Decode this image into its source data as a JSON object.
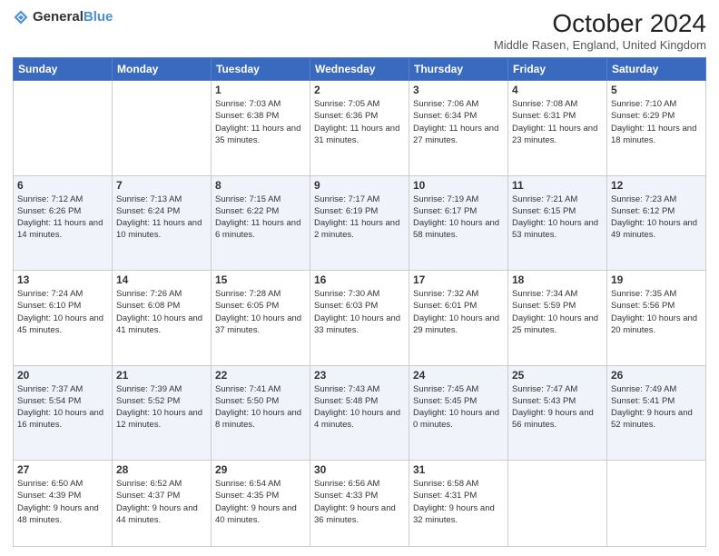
{
  "logo": {
    "text_general": "General",
    "text_blue": "Blue"
  },
  "header": {
    "month_title": "October 2024",
    "location": "Middle Rasen, England, United Kingdom"
  },
  "weekdays": [
    "Sunday",
    "Monday",
    "Tuesday",
    "Wednesday",
    "Thursday",
    "Friday",
    "Saturday"
  ],
  "weeks": [
    [
      {
        "day": "",
        "sunrise": "",
        "sunset": "",
        "daylight": ""
      },
      {
        "day": "",
        "sunrise": "",
        "sunset": "",
        "daylight": ""
      },
      {
        "day": "1",
        "sunrise": "Sunrise: 7:03 AM",
        "sunset": "Sunset: 6:38 PM",
        "daylight": "Daylight: 11 hours and 35 minutes."
      },
      {
        "day": "2",
        "sunrise": "Sunrise: 7:05 AM",
        "sunset": "Sunset: 6:36 PM",
        "daylight": "Daylight: 11 hours and 31 minutes."
      },
      {
        "day": "3",
        "sunrise": "Sunrise: 7:06 AM",
        "sunset": "Sunset: 6:34 PM",
        "daylight": "Daylight: 11 hours and 27 minutes."
      },
      {
        "day": "4",
        "sunrise": "Sunrise: 7:08 AM",
        "sunset": "Sunset: 6:31 PM",
        "daylight": "Daylight: 11 hours and 23 minutes."
      },
      {
        "day": "5",
        "sunrise": "Sunrise: 7:10 AM",
        "sunset": "Sunset: 6:29 PM",
        "daylight": "Daylight: 11 hours and 18 minutes."
      }
    ],
    [
      {
        "day": "6",
        "sunrise": "Sunrise: 7:12 AM",
        "sunset": "Sunset: 6:26 PM",
        "daylight": "Daylight: 11 hours and 14 minutes."
      },
      {
        "day": "7",
        "sunrise": "Sunrise: 7:13 AM",
        "sunset": "Sunset: 6:24 PM",
        "daylight": "Daylight: 11 hours and 10 minutes."
      },
      {
        "day": "8",
        "sunrise": "Sunrise: 7:15 AM",
        "sunset": "Sunset: 6:22 PM",
        "daylight": "Daylight: 11 hours and 6 minutes."
      },
      {
        "day": "9",
        "sunrise": "Sunrise: 7:17 AM",
        "sunset": "Sunset: 6:19 PM",
        "daylight": "Daylight: 11 hours and 2 minutes."
      },
      {
        "day": "10",
        "sunrise": "Sunrise: 7:19 AM",
        "sunset": "Sunset: 6:17 PM",
        "daylight": "Daylight: 10 hours and 58 minutes."
      },
      {
        "day": "11",
        "sunrise": "Sunrise: 7:21 AM",
        "sunset": "Sunset: 6:15 PM",
        "daylight": "Daylight: 10 hours and 53 minutes."
      },
      {
        "day": "12",
        "sunrise": "Sunrise: 7:23 AM",
        "sunset": "Sunset: 6:12 PM",
        "daylight": "Daylight: 10 hours and 49 minutes."
      }
    ],
    [
      {
        "day": "13",
        "sunrise": "Sunrise: 7:24 AM",
        "sunset": "Sunset: 6:10 PM",
        "daylight": "Daylight: 10 hours and 45 minutes."
      },
      {
        "day": "14",
        "sunrise": "Sunrise: 7:26 AM",
        "sunset": "Sunset: 6:08 PM",
        "daylight": "Daylight: 10 hours and 41 minutes."
      },
      {
        "day": "15",
        "sunrise": "Sunrise: 7:28 AM",
        "sunset": "Sunset: 6:05 PM",
        "daylight": "Daylight: 10 hours and 37 minutes."
      },
      {
        "day": "16",
        "sunrise": "Sunrise: 7:30 AM",
        "sunset": "Sunset: 6:03 PM",
        "daylight": "Daylight: 10 hours and 33 minutes."
      },
      {
        "day": "17",
        "sunrise": "Sunrise: 7:32 AM",
        "sunset": "Sunset: 6:01 PM",
        "daylight": "Daylight: 10 hours and 29 minutes."
      },
      {
        "day": "18",
        "sunrise": "Sunrise: 7:34 AM",
        "sunset": "Sunset: 5:59 PM",
        "daylight": "Daylight: 10 hours and 25 minutes."
      },
      {
        "day": "19",
        "sunrise": "Sunrise: 7:35 AM",
        "sunset": "Sunset: 5:56 PM",
        "daylight": "Daylight: 10 hours and 20 minutes."
      }
    ],
    [
      {
        "day": "20",
        "sunrise": "Sunrise: 7:37 AM",
        "sunset": "Sunset: 5:54 PM",
        "daylight": "Daylight: 10 hours and 16 minutes."
      },
      {
        "day": "21",
        "sunrise": "Sunrise: 7:39 AM",
        "sunset": "Sunset: 5:52 PM",
        "daylight": "Daylight: 10 hours and 12 minutes."
      },
      {
        "day": "22",
        "sunrise": "Sunrise: 7:41 AM",
        "sunset": "Sunset: 5:50 PM",
        "daylight": "Daylight: 10 hours and 8 minutes."
      },
      {
        "day": "23",
        "sunrise": "Sunrise: 7:43 AM",
        "sunset": "Sunset: 5:48 PM",
        "daylight": "Daylight: 10 hours and 4 minutes."
      },
      {
        "day": "24",
        "sunrise": "Sunrise: 7:45 AM",
        "sunset": "Sunset: 5:45 PM",
        "daylight": "Daylight: 10 hours and 0 minutes."
      },
      {
        "day": "25",
        "sunrise": "Sunrise: 7:47 AM",
        "sunset": "Sunset: 5:43 PM",
        "daylight": "Daylight: 9 hours and 56 minutes."
      },
      {
        "day": "26",
        "sunrise": "Sunrise: 7:49 AM",
        "sunset": "Sunset: 5:41 PM",
        "daylight": "Daylight: 9 hours and 52 minutes."
      }
    ],
    [
      {
        "day": "27",
        "sunrise": "Sunrise: 6:50 AM",
        "sunset": "Sunset: 4:39 PM",
        "daylight": "Daylight: 9 hours and 48 minutes."
      },
      {
        "day": "28",
        "sunrise": "Sunrise: 6:52 AM",
        "sunset": "Sunset: 4:37 PM",
        "daylight": "Daylight: 9 hours and 44 minutes."
      },
      {
        "day": "29",
        "sunrise": "Sunrise: 6:54 AM",
        "sunset": "Sunset: 4:35 PM",
        "daylight": "Daylight: 9 hours and 40 minutes."
      },
      {
        "day": "30",
        "sunrise": "Sunrise: 6:56 AM",
        "sunset": "Sunset: 4:33 PM",
        "daylight": "Daylight: 9 hours and 36 minutes."
      },
      {
        "day": "31",
        "sunrise": "Sunrise: 6:58 AM",
        "sunset": "Sunset: 4:31 PM",
        "daylight": "Daylight: 9 hours and 32 minutes."
      },
      {
        "day": "",
        "sunrise": "",
        "sunset": "",
        "daylight": ""
      },
      {
        "day": "",
        "sunrise": "",
        "sunset": "",
        "daylight": ""
      }
    ]
  ]
}
